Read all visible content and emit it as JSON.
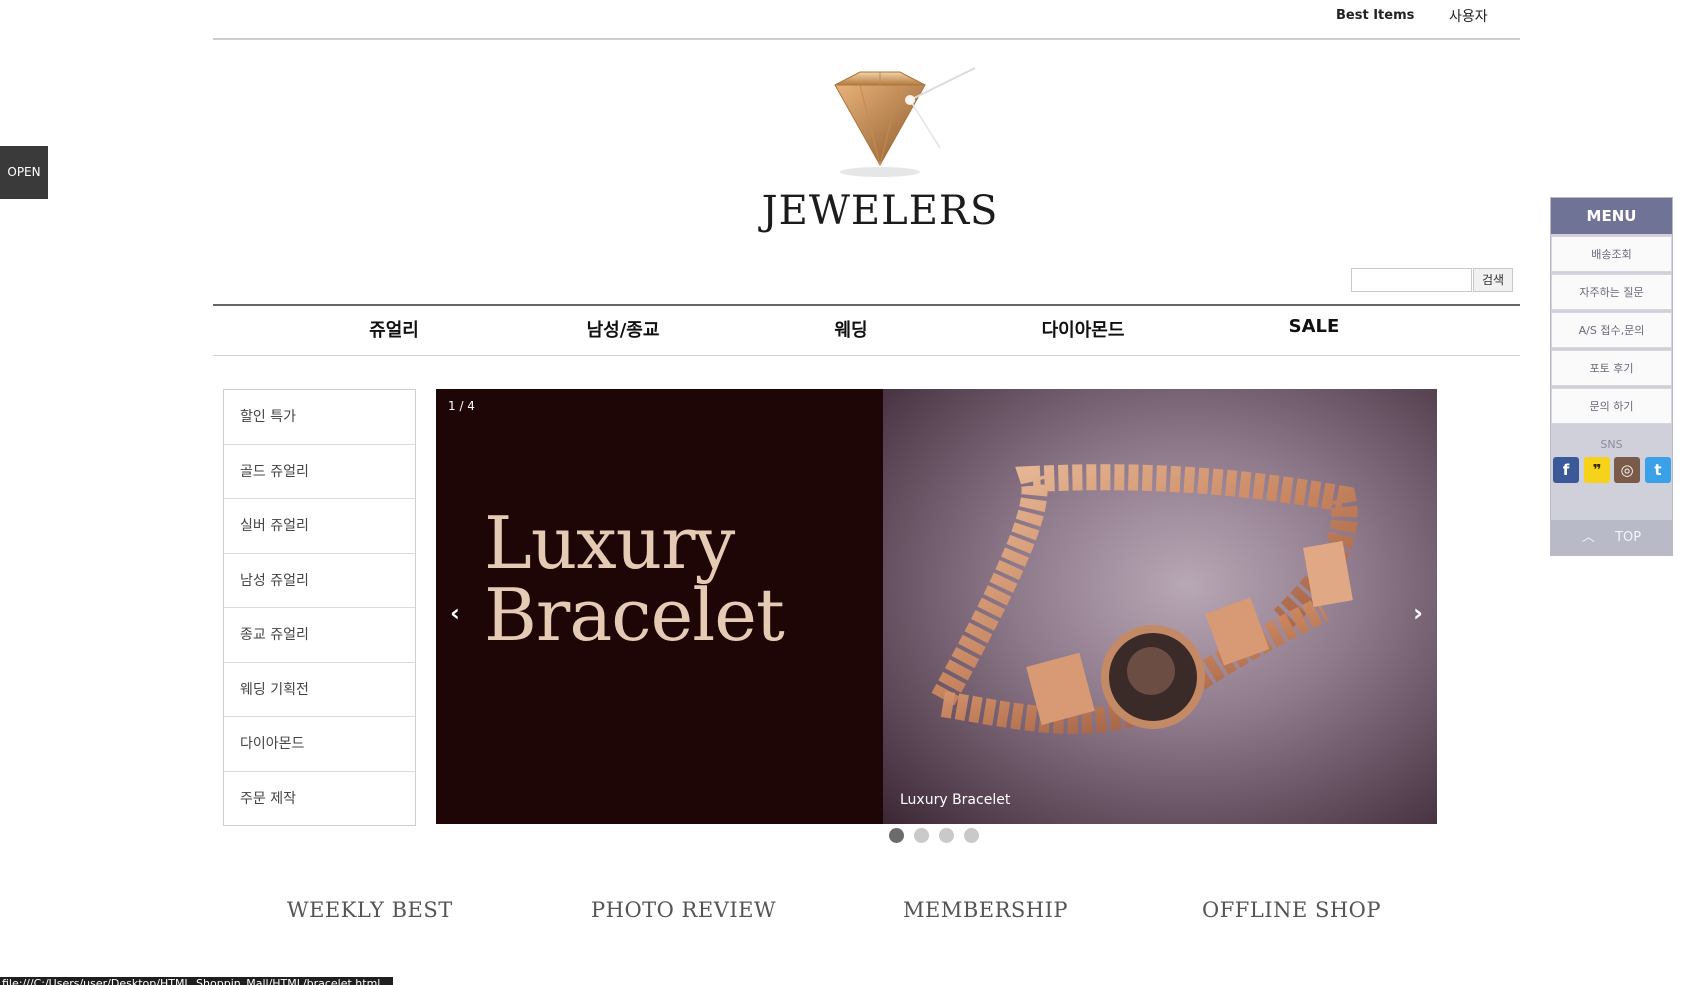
{
  "topnav": {
    "links": [
      "Best Items",
      "사용자"
    ]
  },
  "logo": {
    "text": "JEWELERS"
  },
  "search": {
    "placeholder": "",
    "button": "검색"
  },
  "categories": [
    "쥬얼리",
    "남성/종교",
    "웨딩",
    "다이아몬드",
    "SALE"
  ],
  "sidemenu": [
    "할인 특가",
    "골드 쥬얼리",
    "실버 쥬얼리",
    "남성 쥬얼리",
    "종교 쥬얼리",
    "웨딩 기획전",
    "다이아몬드",
    "주문 제작"
  ],
  "slider": {
    "counter": "1 / 4",
    "title_line1": "Luxury",
    "title_line2": "Bracelet",
    "caption": "Luxury Bracelet",
    "prev": "‹",
    "next": "›",
    "total_slides": 4,
    "active_slide": 1
  },
  "bottom_links": [
    "WEEKLY BEST",
    "PHOTO REVIEW",
    "MEMBERSHIP",
    "OFFLINE SHOP"
  ],
  "open_tab": "OPEN",
  "quick_menu": {
    "title": "MENU",
    "items": [
      "배송조회",
      "자주하는 질문",
      "A/S 접수,문의",
      "포토 후기",
      "문의 하기"
    ],
    "sns_label": "SNS",
    "sns": [
      "facebook-icon",
      "kakaostory-icon",
      "instagram-icon",
      "twitter-icon"
    ],
    "top": "TOP"
  },
  "status_url": "file:///C:/Users/user/Desktop/HTML_Shoppin_Mall/HTML/bracelet.html",
  "colors": {
    "slider_bg": "#1e0506",
    "title_color": "#e5cbb4",
    "quick_head": "#6f7395",
    "quick_bg": "#cfd0d9"
  }
}
